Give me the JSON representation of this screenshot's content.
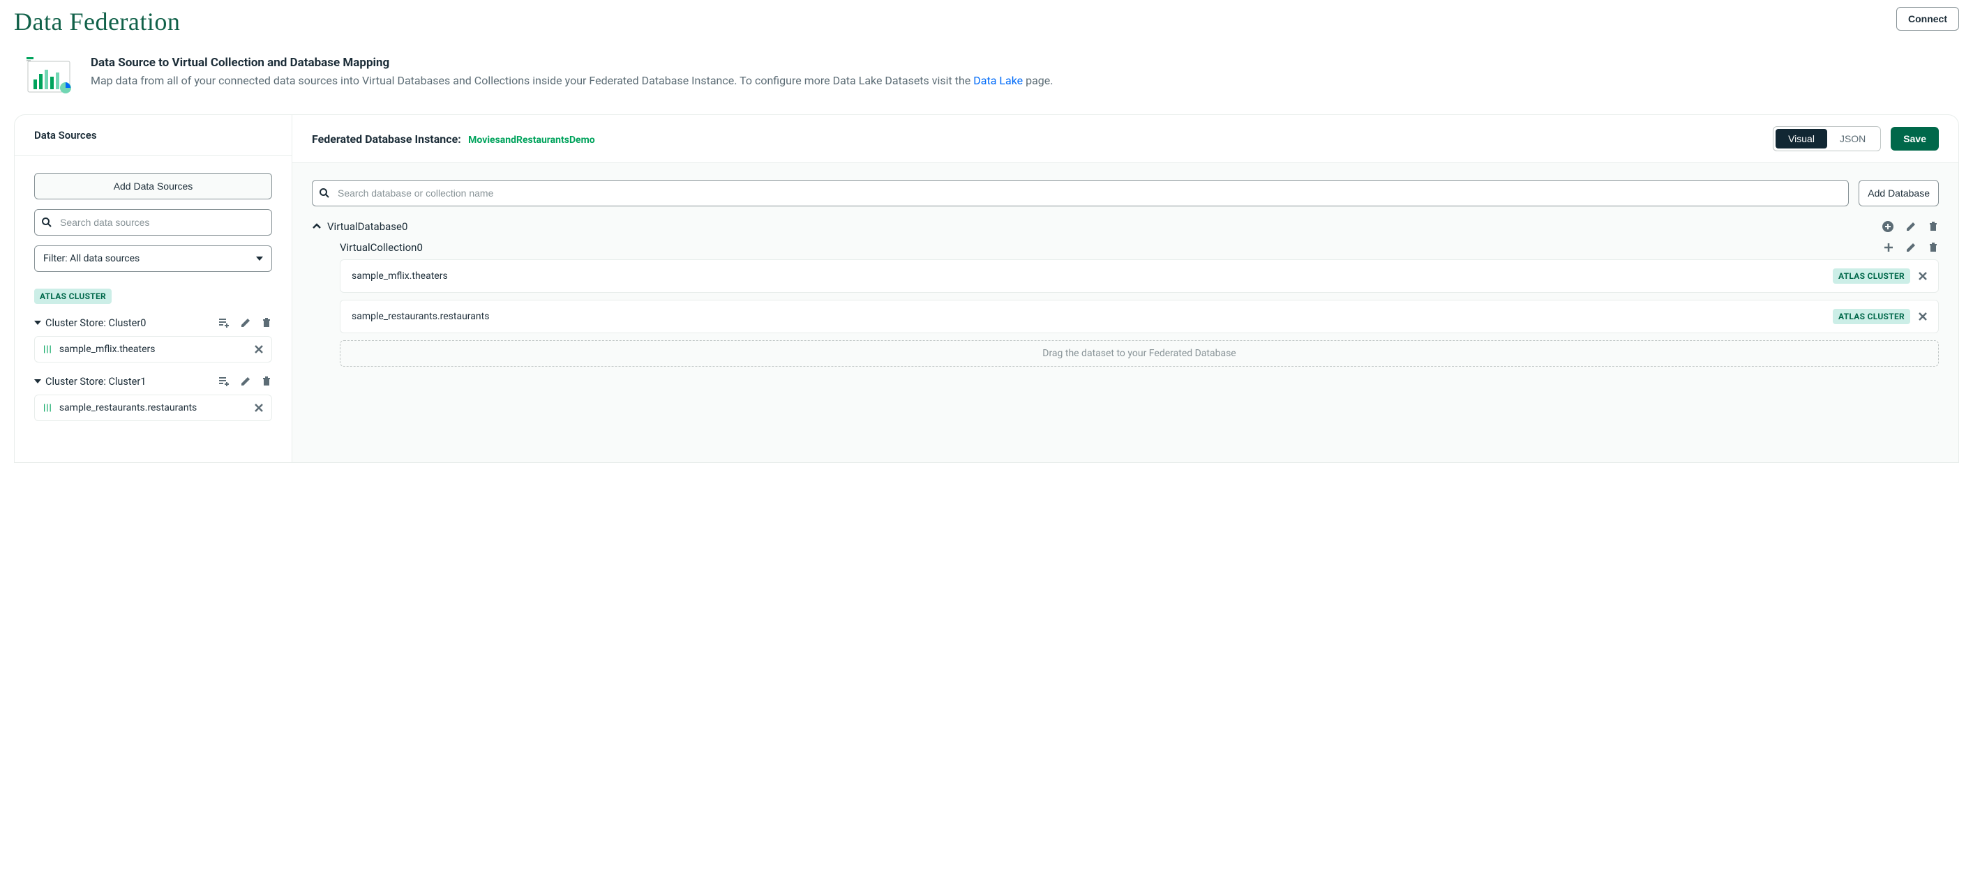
{
  "page": {
    "title": "Data Federation",
    "connect": "Connect"
  },
  "intro": {
    "heading": "Data Source to Virtual Collection and Database Mapping",
    "body_prefix": "Map data from all of your connected data sources into Virtual Databases and Collections inside your Federated Database Instance. To configure more Data Lake Datasets visit the ",
    "link_text": "Data Lake",
    "body_suffix": " page."
  },
  "sidebar": {
    "title": "Data Sources",
    "add_button": "Add Data Sources",
    "search_placeholder": "Search data sources",
    "filter_label": "Filter:",
    "filter_value": "All data sources",
    "cluster_badge": "ATLAS CLUSTER",
    "stores": [
      {
        "label": "Cluster Store: Cluster0",
        "items": [
          {
            "label": "sample_mflix.theaters"
          }
        ]
      },
      {
        "label": "Cluster Store: Cluster1",
        "items": [
          {
            "label": "sample_restaurants.restaurants"
          }
        ]
      }
    ]
  },
  "content": {
    "fed_label": "Federated Database Instance:",
    "fed_name": "MoviesandRestaurantsDemo",
    "view_visual": "Visual",
    "view_json": "JSON",
    "save": "Save",
    "search_placeholder": "Search database or collection name",
    "add_db": "Add Database",
    "vdb": {
      "name": "VirtualDatabase0",
      "collections": [
        {
          "name": "VirtualCollection0",
          "mappings": [
            {
              "label": "sample_mflix.theaters",
              "badge": "ATLAS CLUSTER"
            },
            {
              "label": "sample_restaurants.restaurants",
              "badge": "ATLAS CLUSTER"
            }
          ]
        }
      ]
    },
    "dropzone": "Drag the dataset to your Federated Database"
  }
}
